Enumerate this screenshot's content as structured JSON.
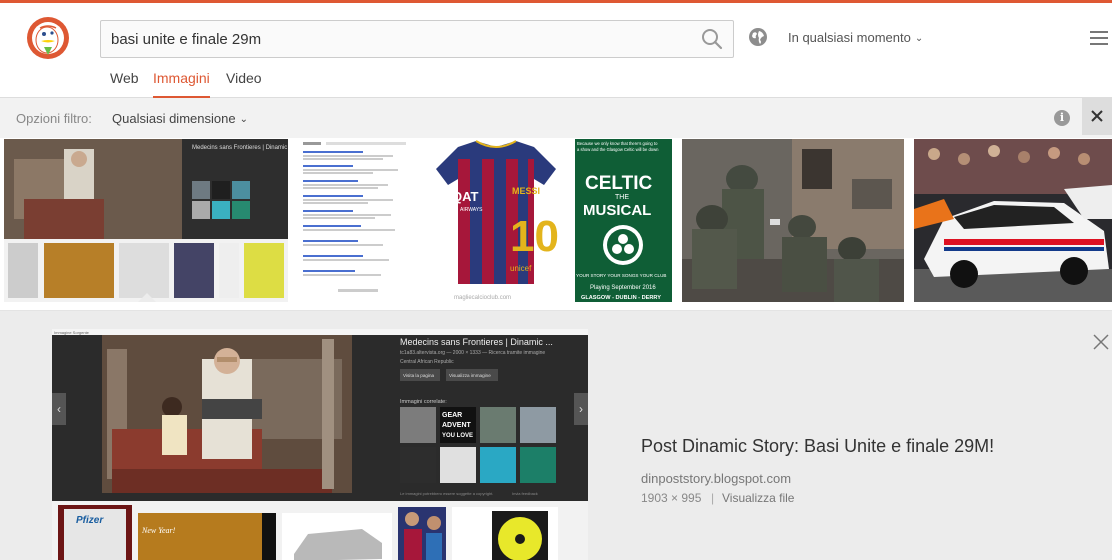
{
  "search": {
    "query": "basi unite e finale 29m"
  },
  "header": {
    "time_filter": "In qualsiasi momento"
  },
  "tabs": [
    {
      "label": "Web"
    },
    {
      "label": "Immagini"
    },
    {
      "label": "Video"
    }
  ],
  "filters": {
    "label": "Opzioni filtro:",
    "size": "Qualsiasi dimensione",
    "info": "i"
  },
  "thumbnails": {
    "shirt_sponsor": "QAT",
    "shirt_sponsor_2": "AIRWAYS",
    "shirt_name": "MESSI",
    "shirt_number": "10",
    "shirt_brand": "unicef",
    "shirt_watermark": "magliecalcioclub.com",
    "celtic_top1": "Because we only know that there's going to",
    "celtic_top2": "a show and the Glasgow Celtic will be down",
    "celtic_line1": "CELTIC",
    "celtic_line2": "THE",
    "celtic_line3": "MUSICAL",
    "celtic_sub": "YOUR STORY  YOUR SONGS  YOUR CLUB",
    "celtic_date": "Playing September 2016",
    "celtic_cities": "GLASGOW - DUBLIN - DERRY",
    "thumb1_header": "Medecins sans Frontieres | Dinamic"
  },
  "preview": {
    "topbar": "Immagine Sorgente",
    "title": "Medecins sans Frontieres | Dinamic ...",
    "meta": "tc1a83.altervista.org — 2000 × 1333 — Ricerca tramite immagine",
    "location": "Central African Republic",
    "btn_visit": "Visita la pagina",
    "btn_view": "Visualizza immagine",
    "related": "Immagini correlate:",
    "gear1": "GEAR",
    "gear2": "ADVENT",
    "gear3": "YOU LOVE",
    "footer": "Le immagini potrebbero essere soggette a copyright.",
    "feedback": "Invia feedback",
    "pfizer": "Pfizer",
    "newyear": "New Year!"
  },
  "result": {
    "title": "Post Dinamic Story: Basi Unite e finale 29M!",
    "domain": "dinpoststory.blogspot.com",
    "dims": "1903 × 995",
    "separator": "|",
    "view_file": "Visualizza file"
  },
  "colors": {
    "accent": "#de5833",
    "filterbar": "#f2f2f2",
    "detail_bg": "#ececec"
  }
}
